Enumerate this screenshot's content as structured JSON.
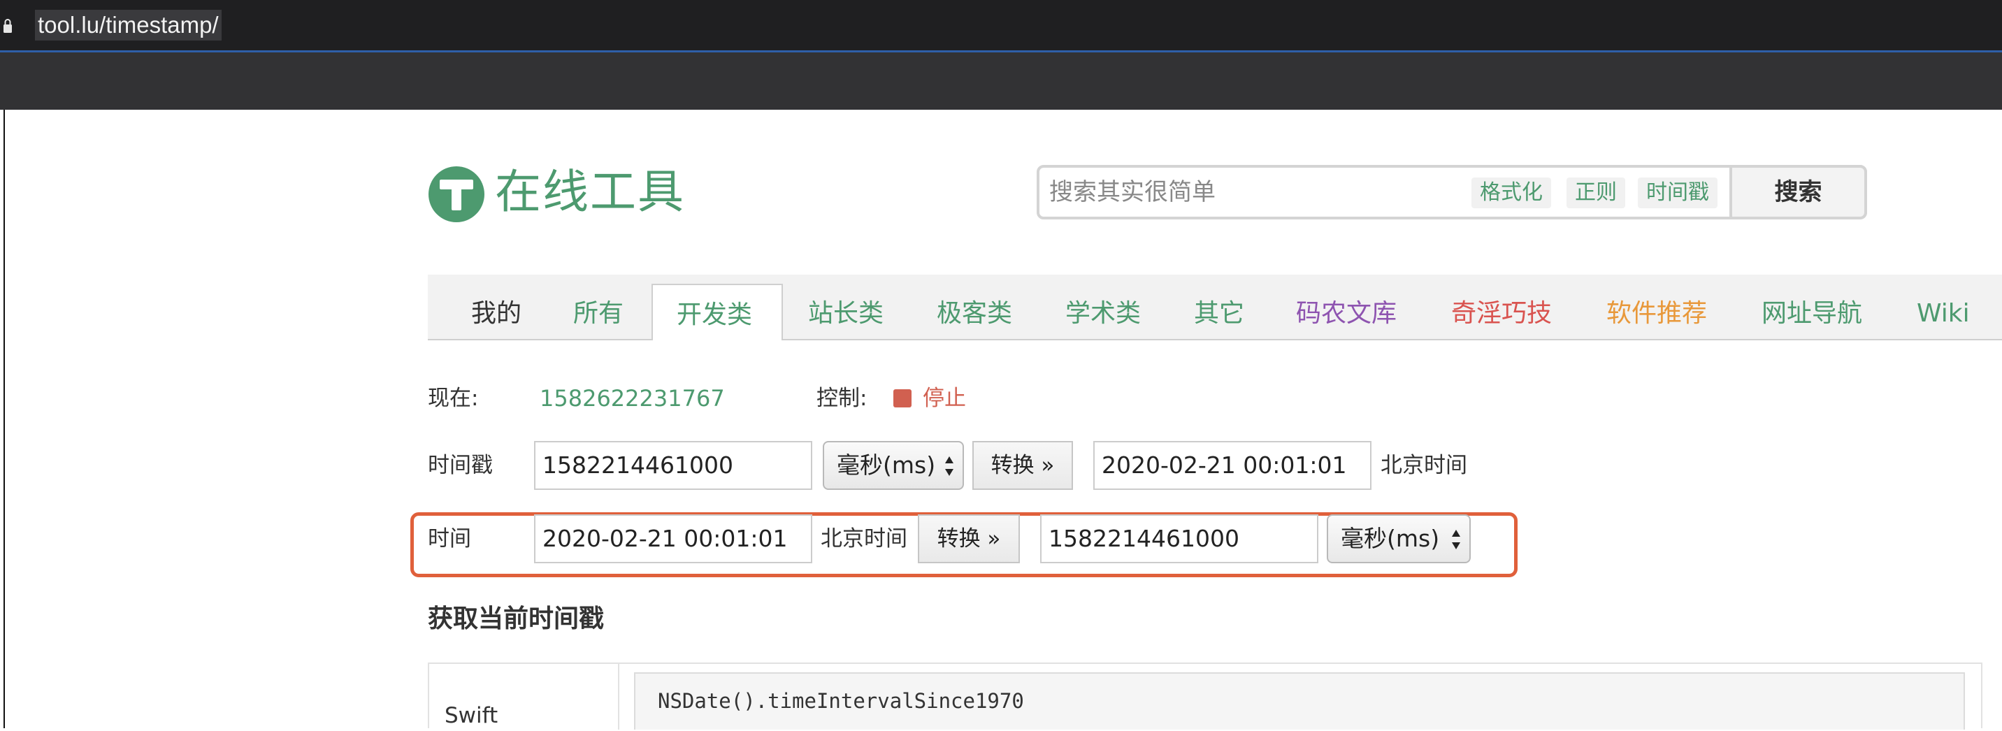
{
  "browser": {
    "url": "tool.lu/timestamp/"
  },
  "header": {
    "site_title": "在线工具",
    "search_placeholder": "搜索其实很简单",
    "search_chips": [
      "格式化",
      "正则",
      "时间戳"
    ],
    "search_button": "搜索"
  },
  "nav": {
    "tabs": [
      {
        "label": "我的",
        "color": "#333333"
      },
      {
        "label": "所有",
        "color": "#4d9a6f"
      },
      {
        "label": "开发类",
        "color": "#4d9a6f",
        "active": true
      },
      {
        "label": "站长类",
        "color": "#4d9a6f"
      },
      {
        "label": "极客类",
        "color": "#4d9a6f"
      },
      {
        "label": "学术类",
        "color": "#4d9a6f"
      },
      {
        "label": "其它",
        "color": "#4d9a6f"
      },
      {
        "label": "码农文库",
        "color": "#8e54b0"
      },
      {
        "label": "奇淫巧技",
        "color": "#d9534f"
      },
      {
        "label": "软件推荐",
        "color": "#e8983a"
      },
      {
        "label": "网址导航",
        "color": "#4d9a6f"
      },
      {
        "label": "Wiki",
        "color": "#4d9a6f"
      }
    ]
  },
  "status": {
    "now_label": "现在:",
    "now_value": "1582622231767",
    "control_label": "控制:",
    "stop_label": "停止"
  },
  "timestamp_row": {
    "label": "时间戳",
    "input_value": "1582214461000",
    "unit": "毫秒(ms)",
    "convert_button": "转换 »",
    "result_value": "2020-02-21 00:01:01",
    "zone": "北京时间"
  },
  "time_row": {
    "label": "时间",
    "input_value": "2020-02-21 00:01:01",
    "zone": "北京时间",
    "convert_button": "转换 »",
    "result_value": "1582214461000",
    "unit": "毫秒(ms)"
  },
  "section": {
    "title": "获取当前时间戳",
    "code_lang": "Swift",
    "code": "NSDate().timeIntervalSince1970"
  },
  "colors": {
    "brand": "#4d9a6f",
    "highlight": "#e0603b",
    "stop": "#d16050"
  }
}
